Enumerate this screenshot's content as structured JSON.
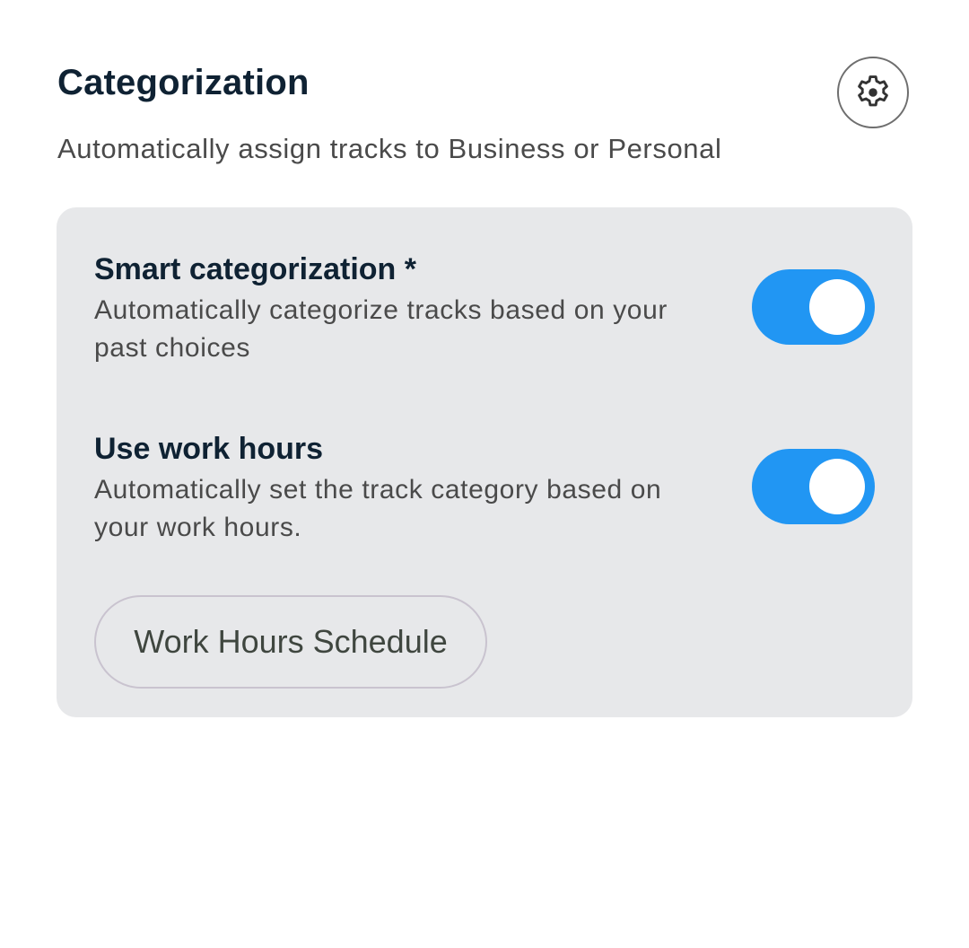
{
  "header": {
    "title": "Categorization",
    "subtitle": "Automatically assign tracks to Business or Personal",
    "settings_icon": "gear-icon"
  },
  "settings": [
    {
      "title": "Smart categorization *",
      "description": "Automatically categorize tracks based on your past choices",
      "enabled": true
    },
    {
      "title": "Use work hours",
      "description": "Automatically set the track category based on your work hours.",
      "enabled": true
    }
  ],
  "schedule_button": {
    "label": "Work Hours Schedule"
  },
  "colors": {
    "accent": "#2196f3",
    "card_background": "#e7e8ea",
    "title_text": "#0f2233",
    "body_text": "#4a4a4a"
  }
}
